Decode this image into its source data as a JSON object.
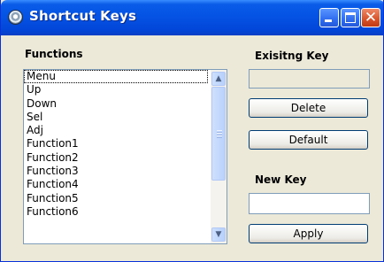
{
  "window": {
    "title": "Shortcut Keys",
    "icon": "app-gear-icon",
    "controls": {
      "minimize": "minimize-icon",
      "maximize": "maximize-icon",
      "close": "✕"
    }
  },
  "functions": {
    "label": "Functions",
    "selected_index": 0,
    "items": [
      "Menu",
      "Up",
      "Down",
      "Sel",
      "Adj",
      "Function1",
      "Function2",
      "Function3",
      "Function4",
      "Function5",
      "Function6"
    ]
  },
  "existing_key": {
    "label": "Exisitng Key",
    "value": ""
  },
  "buttons": {
    "delete": "Delete",
    "default": "Default",
    "apply": "Apply"
  },
  "new_key": {
    "label": "New Key",
    "value": ""
  },
  "scrollbar": {
    "up": "▲",
    "down": "▼"
  },
  "colors": {
    "titlebar": "#0553e4",
    "window_bg": "#ece9d8",
    "close_button": "#d7532a",
    "field_border": "#7f9db9"
  }
}
